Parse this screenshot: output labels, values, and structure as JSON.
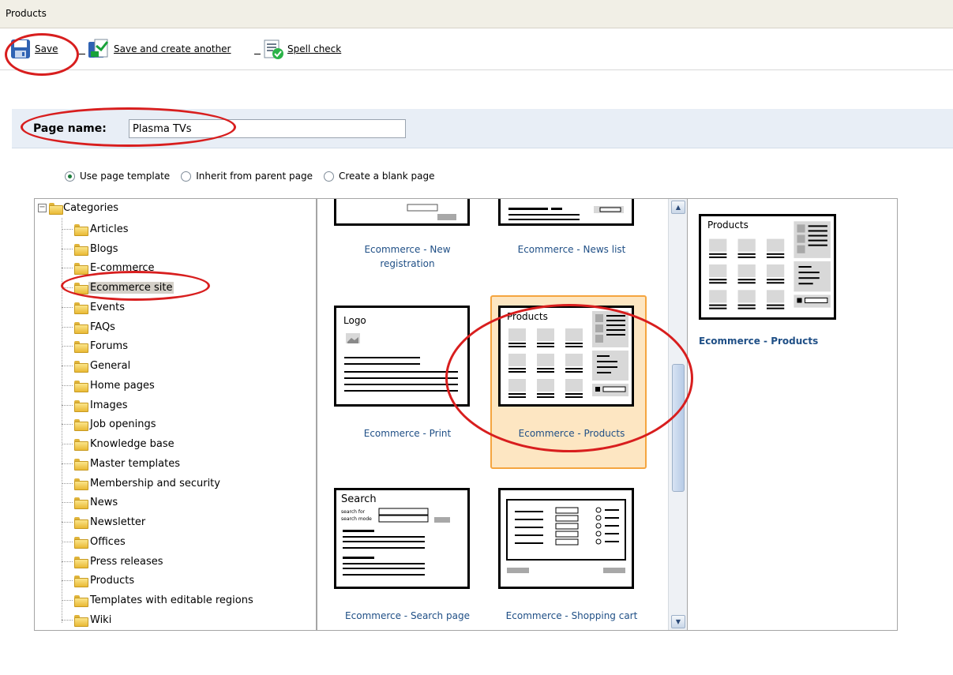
{
  "breadcrumb": {
    "title": "Products"
  },
  "toolbar": {
    "save_label": "Save",
    "save_create_label": "Save and create another",
    "spell_label": "Spell check"
  },
  "page_name": {
    "label": "Page name:",
    "value": "Plasma TVs"
  },
  "options": {
    "template": "Use page template",
    "inherit": "Inherit from parent page",
    "blank": "Create a blank page",
    "selected": "template"
  },
  "tree": {
    "root": "Categories",
    "items": [
      "Articles",
      "Blogs",
      "E-commerce",
      "Ecommerce site",
      "Events",
      "FAQs",
      "Forums",
      "General",
      "Home pages",
      "Images",
      "Job openings",
      "Knowledge base",
      "Master templates",
      "Membership and security",
      "News",
      "Newsletter",
      "Offices",
      "Press releases",
      "Products",
      "Templates with editable regions",
      "Wiki"
    ],
    "selected": "Ecommerce site"
  },
  "gallery": {
    "templates": [
      {
        "name": "Ecommerce - New registration",
        "line1": "Ecommerce - New",
        "line2": "registration"
      },
      {
        "name": "Ecommerce - News list"
      },
      {
        "name": "Ecommerce - Print",
        "logo": "Logo"
      },
      {
        "name": "Ecommerce - Products",
        "heading": "Products"
      },
      {
        "name": "Ecommerce - Search page",
        "heading": "Search",
        "field1": "search for",
        "field2": "search mode"
      },
      {
        "name": "Ecommerce - Shopping cart"
      }
    ],
    "selected": "Ecommerce - Products"
  },
  "preview": {
    "heading": "Products",
    "name": "Ecommerce - Products"
  },
  "colors": {
    "annotation": "#d81e1e",
    "selection": "#f5a540",
    "link": "#1f4f86"
  }
}
